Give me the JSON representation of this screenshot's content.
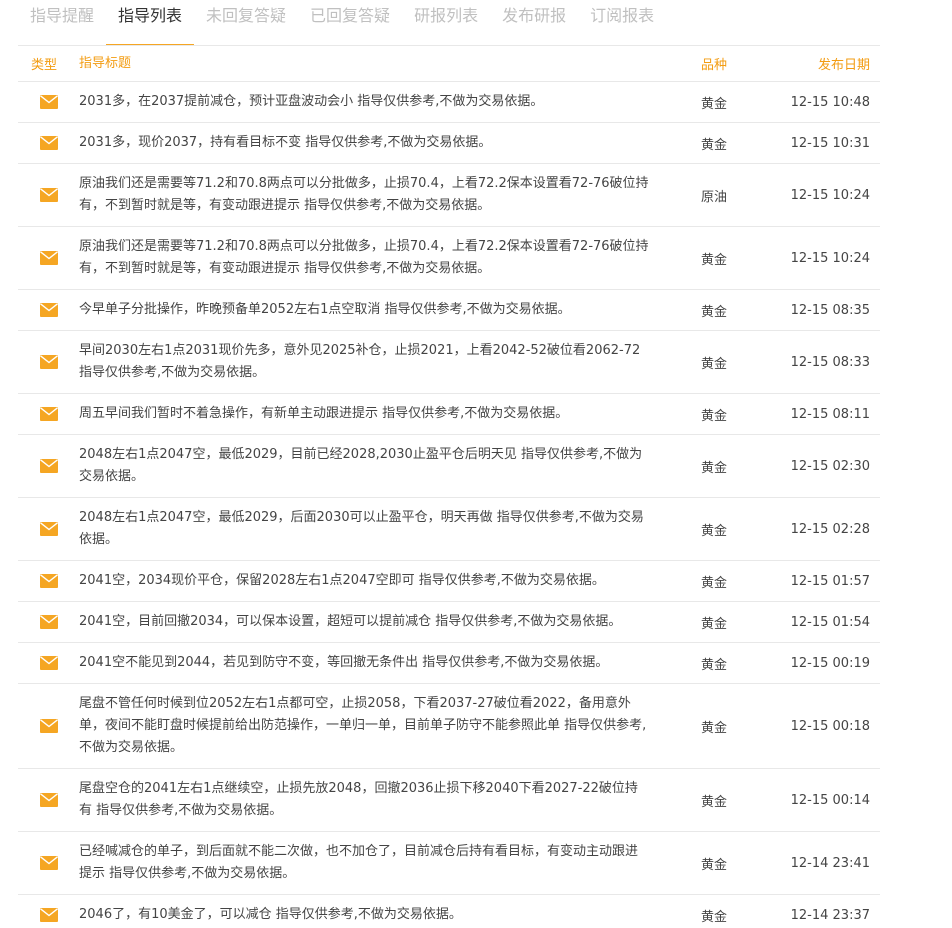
{
  "tabs": [
    {
      "label": "指导提醒",
      "active": false
    },
    {
      "label": "指导列表",
      "active": true
    },
    {
      "label": "未回复答疑",
      "active": false
    },
    {
      "label": "已回复答疑",
      "active": false
    },
    {
      "label": "研报列表",
      "active": false
    },
    {
      "label": "发布研报",
      "active": false
    },
    {
      "label": "订阅报表",
      "active": false
    }
  ],
  "table": {
    "headers": {
      "type": "类型",
      "title": "指导标题",
      "variety": "品种",
      "date": "发布日期"
    },
    "rows": [
      {
        "icon": "mail-icon",
        "title": "2031多，在2037提前减仓，预计亚盘波动会小 指导仅供参考,不做为交易依据。",
        "variety": "黄金",
        "date": "12-15 10:48"
      },
      {
        "icon": "mail-icon",
        "title": "2031多，现价2037，持有看目标不变 指导仅供参考,不做为交易依据。",
        "variety": "黄金",
        "date": "12-15 10:31"
      },
      {
        "icon": "mail-icon",
        "title": "原油我们还是需要等71.2和70.8两点可以分批做多，止损70.4，上看72.2保本设置看72-76破位持有，不到暂时就是等，有变动跟进提示 指导仅供参考,不做为交易依据。",
        "variety": "原油",
        "date": "12-15 10:24"
      },
      {
        "icon": "mail-icon",
        "title": "原油我们还是需要等71.2和70.8两点可以分批做多，止损70.4，上看72.2保本设置看72-76破位持有，不到暂时就是等，有变动跟进提示 指导仅供参考,不做为交易依据。",
        "variety": "黄金",
        "date": "12-15 10:24"
      },
      {
        "icon": "mail-icon",
        "title": "今早单子分批操作，昨晚预备单2052左右1点空取消 指导仅供参考,不做为交易依据。",
        "variety": "黄金",
        "date": "12-15 08:35"
      },
      {
        "icon": "mail-icon",
        "title": "早间2030左右1点2031现价先多，意外见2025补仓，止损2021，上看2042-52破位看2062-72 指导仅供参考,不做为交易依据。",
        "variety": "黄金",
        "date": "12-15 08:33"
      },
      {
        "icon": "mail-icon",
        "title": "周五早间我们暂时不着急操作，有新单主动跟进提示 指导仅供参考,不做为交易依据。",
        "variety": "黄金",
        "date": "12-15 08:11"
      },
      {
        "icon": "mail-icon",
        "title": "2048左右1点2047空，最低2029，目前已经2028,2030止盈平仓后明天见 指导仅供参考,不做为交易依据。",
        "variety": "黄金",
        "date": "12-15 02:30"
      },
      {
        "icon": "mail-icon",
        "title": "2048左右1点2047空，最低2029，后面2030可以止盈平仓，明天再做 指导仅供参考,不做为交易依据。",
        "variety": "黄金",
        "date": "12-15 02:28"
      },
      {
        "icon": "mail-icon",
        "title": "2041空，2034现价平仓，保留2028左右1点2047空即可 指导仅供参考,不做为交易依据。",
        "variety": "黄金",
        "date": "12-15 01:57"
      },
      {
        "icon": "mail-icon",
        "title": "2041空，目前回撤2034，可以保本设置，超短可以提前减仓 指导仅供参考,不做为交易依据。",
        "variety": "黄金",
        "date": "12-15 01:54"
      },
      {
        "icon": "mail-icon",
        "title": "2041空不能见到2044，若见到防守不变，等回撤无条件出 指导仅供参考,不做为交易依据。",
        "variety": "黄金",
        "date": "12-15 00:19"
      },
      {
        "icon": "mail-icon",
        "title": "尾盘不管任何时候到位2052左右1点都可空，止损2058，下看2037-27破位看2022，备用意外单，夜间不能盯盘时候提前给出防范操作，一单归一单，目前单子防守不能参照此单 指导仅供参考,不做为交易依据。",
        "variety": "黄金",
        "date": "12-15 00:18"
      },
      {
        "icon": "mail-icon",
        "title": "尾盘空仓的2041左右1点继续空，止损先放2048，回撤2036止损下移2040下看2027-22破位持有 指导仅供参考,不做为交易依据。",
        "variety": "黄金",
        "date": "12-15 00:14"
      },
      {
        "icon": "mail-icon",
        "title": "已经喊减仓的单子，到后面就不能二次做，也不加仓了，目前减仓后持有看目标，有变动主动跟进提示 指导仅供参考,不做为交易依据。",
        "variety": "黄金",
        "date": "12-14 23:41"
      },
      {
        "icon": "mail-icon",
        "title": "2046了，有10美金了，可以减仓 指导仅供参考,不做为交易依据。",
        "variety": "黄金",
        "date": "12-14 23:37"
      }
    ]
  },
  "colors": {
    "accent": "#f5a623",
    "header_text": "#f39c12",
    "tab_inactive": "#c0c0c0",
    "border": "#e8e8e8"
  }
}
